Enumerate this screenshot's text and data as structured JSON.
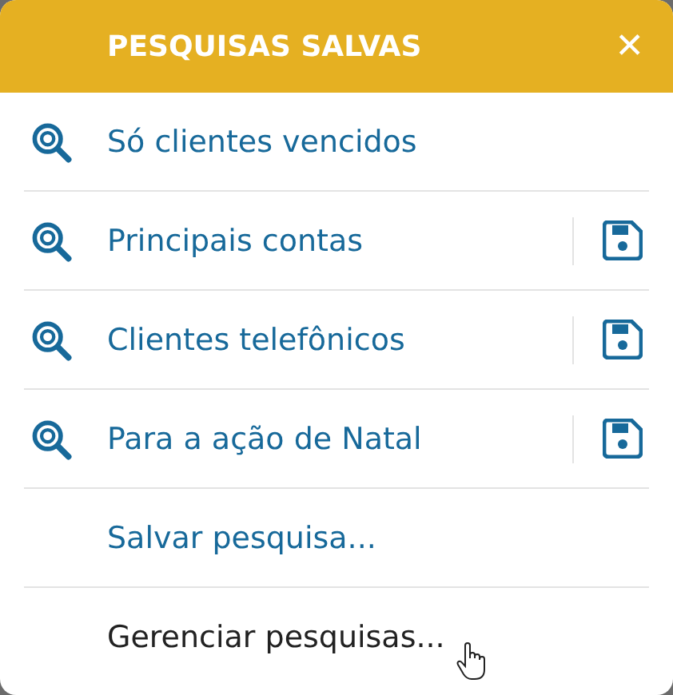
{
  "dialog": {
    "title": "PESQUISAS SALVAS",
    "close": "✕"
  },
  "searches": [
    {
      "label": "Só clientes vencidos",
      "saveable": false
    },
    {
      "label": "Principais contas",
      "saveable": true
    },
    {
      "label": "Clientes telefônicos",
      "saveable": true
    },
    {
      "label": "Para a ação de Natal",
      "saveable": true
    }
  ],
  "actions": [
    {
      "label": "Salvar pesquisa...",
      "hovered": false
    },
    {
      "label": "Gerenciar pesquisas...",
      "hovered": true
    }
  ]
}
